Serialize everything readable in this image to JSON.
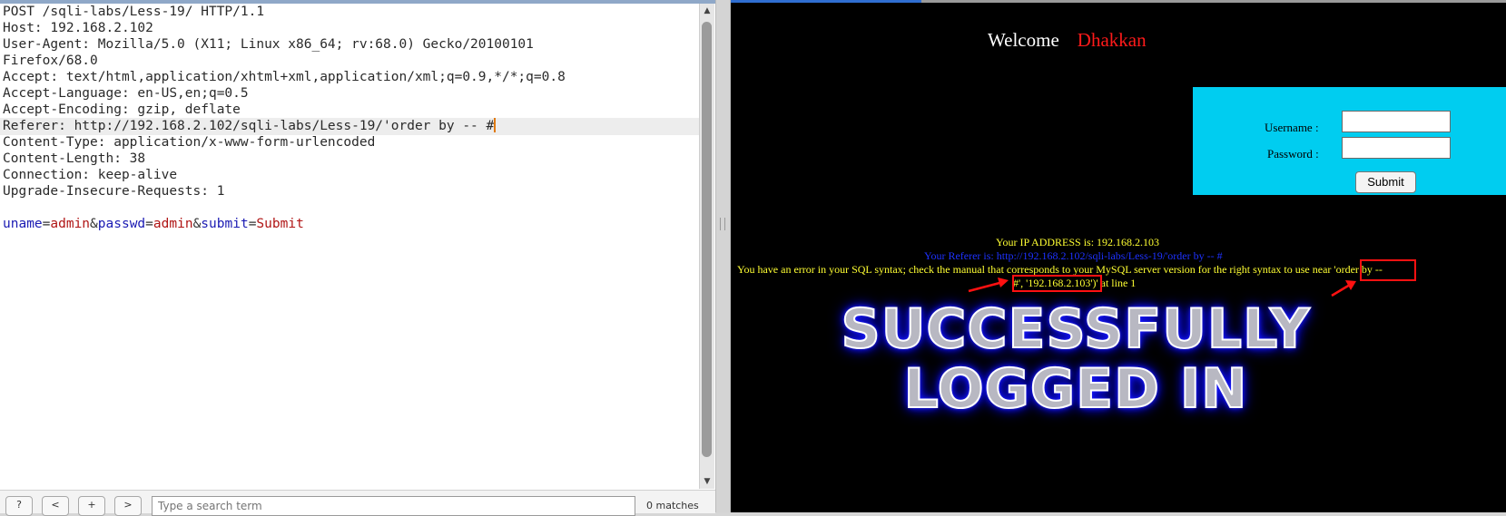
{
  "request": {
    "lines": [
      "POST /sqli-labs/Less-19/ HTTP/1.1",
      "Host: 192.168.2.102",
      "User-Agent: Mozilla/5.0 (X11; Linux x86_64; rv:68.0) Gecko/20100101",
      "Firefox/68.0",
      "Accept: text/html,application/xhtml+xml,application/xml;q=0.9,*/*;q=0.8",
      "Accept-Language: en-US,en;q=0.5",
      "Accept-Encoding: gzip, deflate",
      "Referer: http://192.168.2.102/sqli-labs/Less-19/'order by -- #",
      "Content-Type: application/x-www-form-urlencoded",
      "Content-Length: 38",
      "Connection: keep-alive",
      "Upgrade-Insecure-Requests: 1"
    ],
    "body_params": [
      {
        "key": "uname",
        "value": "admin"
      },
      {
        "key": "passwd",
        "value": "admin"
      },
      {
        "key": "submit",
        "value": "Submit"
      }
    ],
    "separators": {
      "equals": "=",
      "amp": "&"
    }
  },
  "toolbar": {
    "buttons": [
      "?",
      "<",
      "+",
      ">"
    ],
    "search_placeholder": "Type a search term",
    "match_count": "0 matches"
  },
  "page": {
    "welcome": "Welcome",
    "welcome_name": "Dhakkan",
    "username_label": "Username :",
    "password_label": "Password :",
    "submit_label": "Submit",
    "ip_line": "Your IP ADDRESS is: 192.168.2.103",
    "referer_line": "Your Referer is: http://192.168.2.102/sqli-labs/Less-19/'order by -- #",
    "error_line": "You have an error in your SQL syntax; check the manual that corresponds to your MySQL server version for the right syntax to use near 'order by --",
    "error_line2": "#', '192.168.2.103')' at line 1",
    "success_line1": "SUCCESSFULLY",
    "success_line2": "LOGGED IN"
  },
  "colors": {
    "annotation": "#ff1111",
    "login_box": "#00cdf0",
    "message_text": "#ffff32",
    "referer_text": "#1e32ff",
    "welcome_name": "#ff1a1a",
    "param_key": "#1a1ab3",
    "param_value": "#b01515",
    "caret": "#e07a10"
  }
}
